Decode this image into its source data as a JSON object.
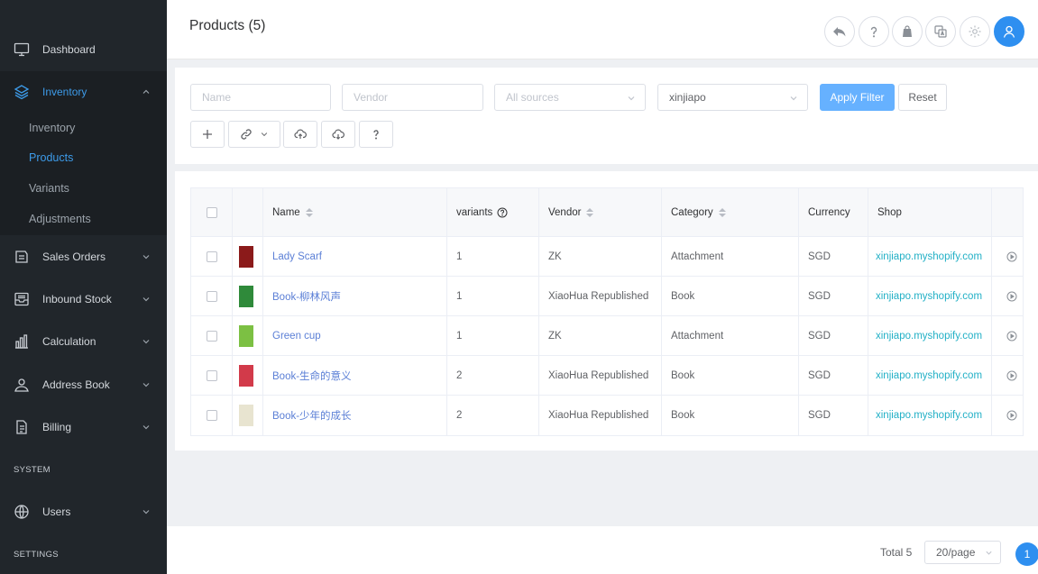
{
  "sidebar": {
    "dashboard": "Dashboard",
    "inventory": "Inventory",
    "sub_items": [
      "Inventory",
      "Products",
      "Variants",
      "Adjustments"
    ],
    "sales_orders": "Sales Orders",
    "inbound_stock": "Inbound Stock",
    "calculation": "Calculation",
    "address_book": "Address Book",
    "billing": "Billing",
    "system_label": "SYSTEM",
    "users": "Users",
    "settings_label": "SETTINGS"
  },
  "header": {
    "title": "Products (5)",
    "icons": [
      "reply-icon",
      "help-icon",
      "shopify-icon",
      "translate-icon",
      "settings-icon",
      "user-icon"
    ]
  },
  "filters": {
    "name_placeholder": "Name",
    "vendor_placeholder": "Vendor",
    "source_placeholder": "All sources",
    "shop_value": "xinjiapo",
    "apply_label": "Apply Filter",
    "reset_label": "Reset"
  },
  "table": {
    "columns": [
      "Name",
      "variants",
      "Vendor",
      "Category",
      "Currency",
      "Shop"
    ],
    "rows": [
      {
        "name": "Lady Scarf",
        "variants": "1",
        "vendor": "ZK",
        "category": "Attachment",
        "currency": "SGD",
        "shop": "xinjiapo.myshopify.com",
        "thumb_color": "#8b1a1a"
      },
      {
        "name": "Book-柳林风声",
        "variants": "1",
        "vendor": "XiaoHua Republished",
        "category": "Book",
        "currency": "SGD",
        "shop": "xinjiapo.myshopify.com",
        "thumb_color": "#2f8a3a"
      },
      {
        "name": "Green cup",
        "variants": "1",
        "vendor": "ZK",
        "category": "Attachment",
        "currency": "SGD",
        "shop": "xinjiapo.myshopify.com",
        "thumb_color": "#7cc043"
      },
      {
        "name": "Book-生命的意义",
        "variants": "2",
        "vendor": "XiaoHua Republished",
        "category": "Book",
        "currency": "SGD",
        "shop": "xinjiapo.myshopify.com",
        "thumb_color": "#d23a4a"
      },
      {
        "name": "Book-少年的成长",
        "variants": "2",
        "vendor": "XiaoHua Republished",
        "category": "Book",
        "currency": "SGD",
        "shop": "xinjiapo.myshopify.com",
        "thumb_color": "#e8e4d0"
      }
    ]
  },
  "pagination": {
    "total": "Total 5",
    "page_size": "20/page",
    "current_page": "1"
  },
  "colors": {
    "sidebar_bg": "#21262b",
    "accent": "#2e8ff0",
    "link": "#5b7fd6",
    "shop_link": "#22b0c6"
  }
}
